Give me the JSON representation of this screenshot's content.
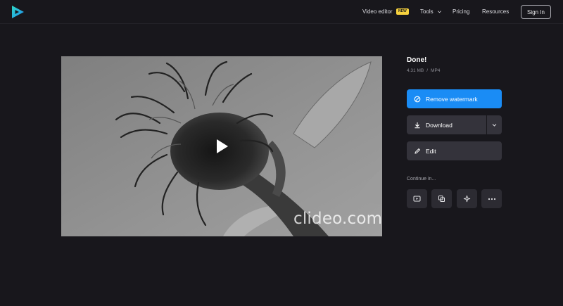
{
  "header": {
    "logo_icon": "clideo-play-logo-icon",
    "nav": {
      "video_editor": "Video editor",
      "new_badge": "NEW",
      "tools": "Tools",
      "pricing": "Pricing",
      "resources": "Resources"
    },
    "sign_in": "Sign In"
  },
  "video": {
    "watermark": "clideo.com",
    "play_icon": "play-icon"
  },
  "result": {
    "title": "Done!",
    "file_size": "4.31 MB",
    "separator": "/",
    "format": "MP4"
  },
  "actions": {
    "remove_watermark": "Remove watermark",
    "download": "Download",
    "edit": "Edit"
  },
  "continue": {
    "label": "Continue in...",
    "tools": [
      {
        "icon": "video-player-icon"
      },
      {
        "icon": "copy-layers-icon"
      },
      {
        "icon": "sparkle-icon"
      },
      {
        "icon": "more-dots-icon"
      }
    ]
  },
  "colors": {
    "background": "#18171c",
    "accent": "#1a8cf5",
    "button_dark": "#34333b",
    "badge": "#f7d23e"
  }
}
